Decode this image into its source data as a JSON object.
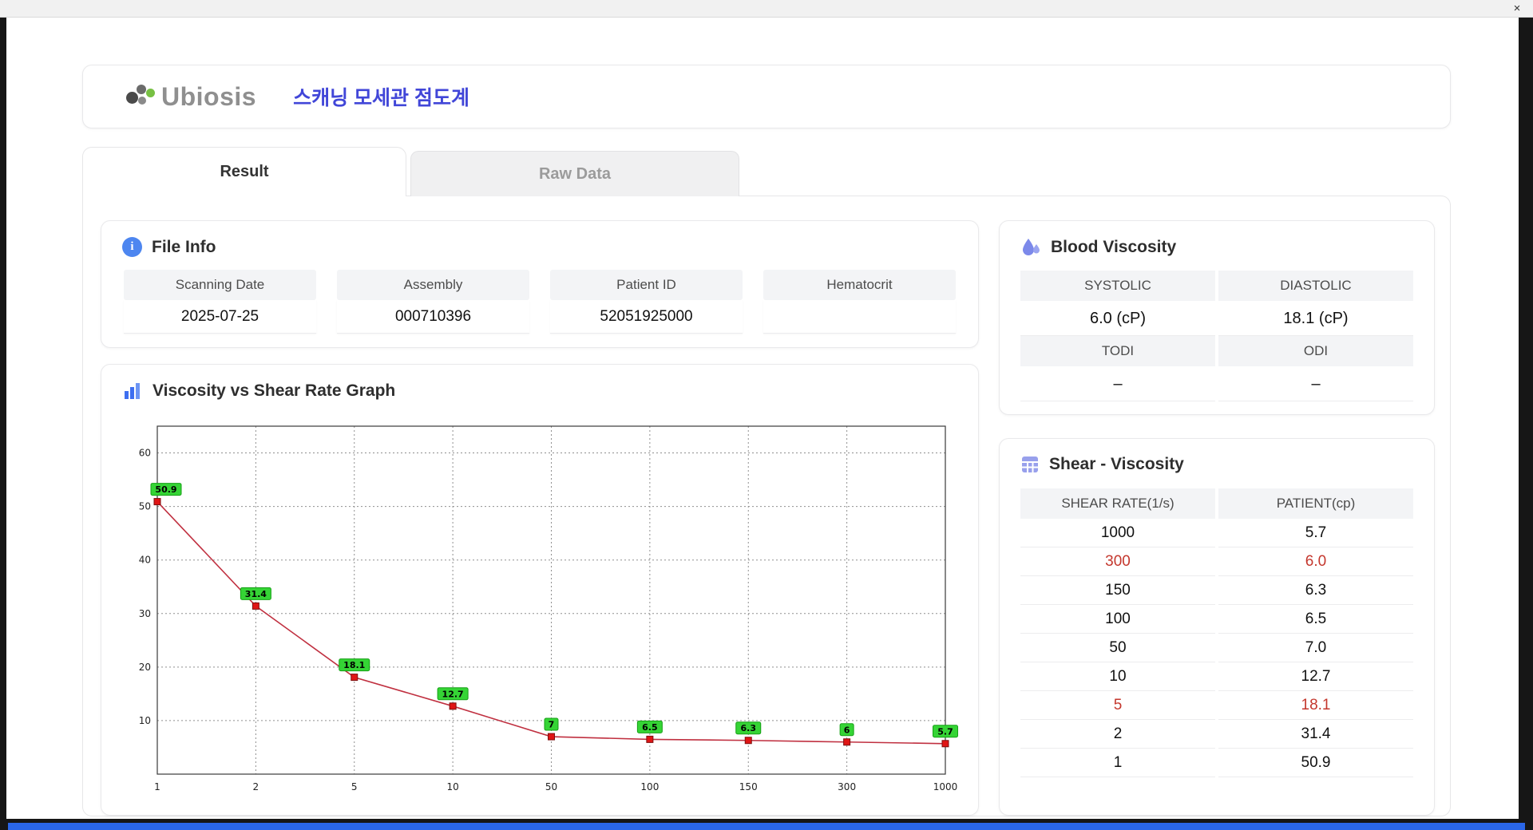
{
  "window": {
    "close_label": "×"
  },
  "header": {
    "logo": "Ubiosis",
    "title": "스캐닝 모세관 점도계"
  },
  "tabs": [
    {
      "label": "Result",
      "active": true
    },
    {
      "label": "Raw Data",
      "active": false
    }
  ],
  "file_info": {
    "title": "File Info",
    "fields": [
      {
        "label": "Scanning Date",
        "value": "2025-07-25"
      },
      {
        "label": "Assembly",
        "value": "000710396"
      },
      {
        "label": "Patient ID",
        "value": "52051925000"
      },
      {
        "label": "Hematocrit",
        "value": ""
      }
    ]
  },
  "blood_viscosity": {
    "title": "Blood Viscosity",
    "cells": [
      {
        "label": "SYSTOLIC",
        "value": "6.0 (cP)"
      },
      {
        "label": "DIASTOLIC",
        "value": "18.1 (cP)"
      },
      {
        "label": "TODI",
        "value": "–"
      },
      {
        "label": "ODI",
        "value": "–"
      }
    ]
  },
  "shear_viscosity": {
    "title": "Shear - Viscosity",
    "columns": [
      "SHEAR RATE(1/s)",
      "PATIENT(cp)"
    ],
    "rows": [
      {
        "shear": "1000",
        "patient": "5.7",
        "highlight": false
      },
      {
        "shear": "300",
        "patient": "6.0",
        "highlight": true
      },
      {
        "shear": "150",
        "patient": "6.3",
        "highlight": false
      },
      {
        "shear": "100",
        "patient": "6.5",
        "highlight": false
      },
      {
        "shear": "50",
        "patient": "7.0",
        "highlight": false
      },
      {
        "shear": "10",
        "patient": "12.7",
        "highlight": false
      },
      {
        "shear": "5",
        "patient": "18.1",
        "highlight": true
      },
      {
        "shear": "2",
        "patient": "31.4",
        "highlight": false
      },
      {
        "shear": "1",
        "patient": "50.9",
        "highlight": false
      }
    ]
  },
  "chart_data": {
    "type": "line",
    "title": "Viscosity vs Shear Rate Graph",
    "x": [
      "1",
      "2",
      "5",
      "10",
      "50",
      "100",
      "150",
      "300",
      "1000"
    ],
    "values": [
      50.9,
      31.4,
      18.1,
      12.7,
      7,
      6.5,
      6.3,
      6,
      5.7
    ],
    "point_labels": [
      "50.9",
      "31.4",
      "18.1",
      "12.7",
      "7",
      "6.5",
      "6.3",
      "6",
      "5.7"
    ],
    "yticks": [
      10,
      20,
      30,
      40,
      50,
      60
    ],
    "ylim": [
      0,
      65
    ],
    "x_scale": "categorical",
    "grid": true,
    "legend": "none",
    "xlabel": "",
    "ylabel": "",
    "line_color": "#c03040",
    "marker_color": "#e01515",
    "label_bg": "#35d435",
    "label_border": "#15a015"
  },
  "colors": {
    "accent_blue": "#4146d8",
    "highlight_red": "#c4372d",
    "bottom_bar": "#2a66e8"
  }
}
